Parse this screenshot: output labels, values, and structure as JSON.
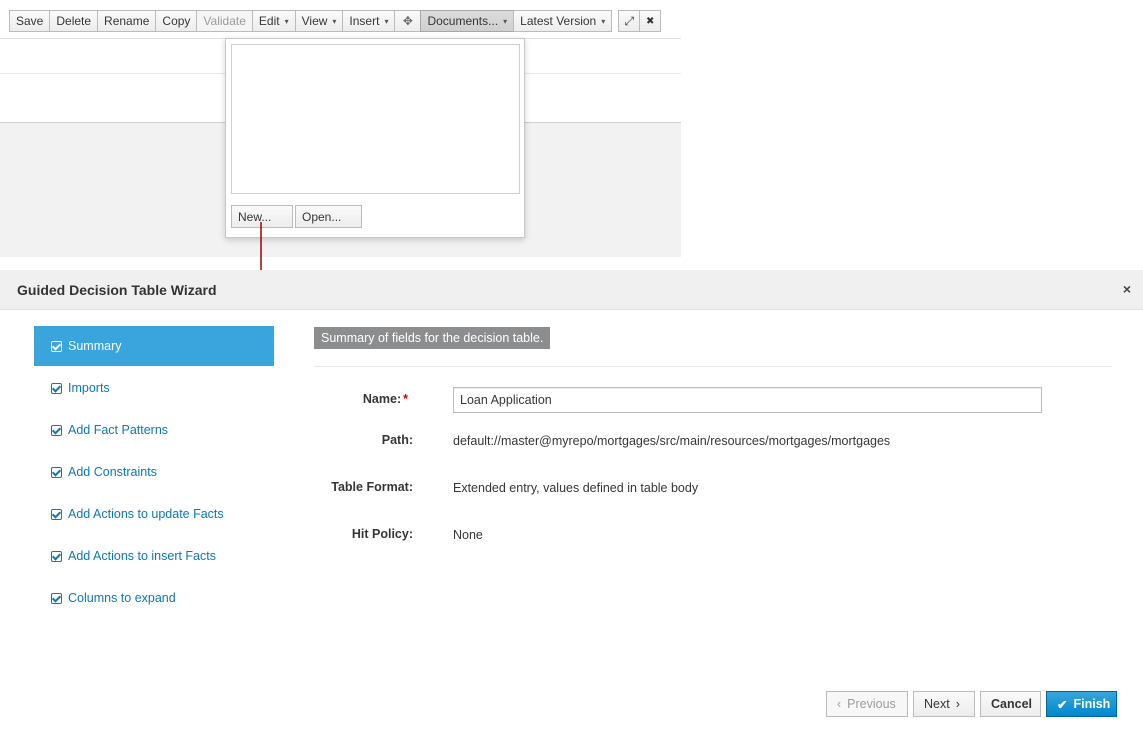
{
  "toolbar": {
    "buttons": [
      "Save",
      "Delete",
      "Rename",
      "Copy",
      "Validate"
    ],
    "edit": "Edit",
    "view": "View",
    "insert": "Insert",
    "documents": "Documents...",
    "latest_version": "Latest Version",
    "caret": "▾",
    "move_icon": "✥",
    "expand_icon": "⤢",
    "close_icon": "✖"
  },
  "documents_popup": {
    "new_label": "New...",
    "open_label": "Open..."
  },
  "wizard": {
    "title": "Guided Decision Table Wizard",
    "close": "×",
    "steps": [
      "Summary",
      "Imports",
      "Add Fact Patterns",
      "Add Constraints",
      "Add Actions to update Facts",
      "Add Actions to insert Facts",
      "Columns to expand"
    ],
    "active_step": "Summary",
    "summary_heading": "Summary of fields for the decision table.",
    "fields": {
      "name_label": "Name:",
      "required_mark": "*",
      "name_value": "Loan Application",
      "path_label": "Path:",
      "path_value": "default://master@myrepo/mortgages/src/main/resources/mortgages/mortgages",
      "format_label": "Table Format:",
      "format_value": "Extended entry, values defined in table body",
      "hit_label": "Hit Policy:",
      "hit_value": "None"
    },
    "footer": {
      "previous": "Previous",
      "previous_icon": "‹",
      "next": "Next",
      "next_icon": "›",
      "cancel": "Cancel",
      "finish": "Finish",
      "finish_icon": "✔"
    }
  },
  "colors": {
    "accent": "#39a5dc",
    "link": "#0c78b5",
    "primary_button": "#0088ce",
    "arrow": "#a30000"
  }
}
